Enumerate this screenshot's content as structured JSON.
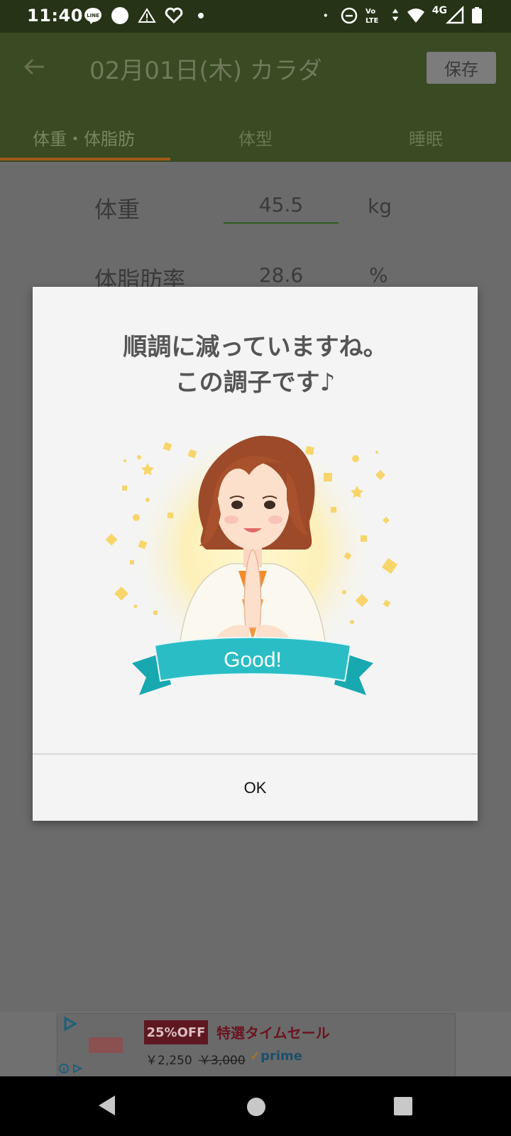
{
  "status_bar": {
    "time": "11:40",
    "left_icons": [
      "line-icon",
      "circle-notification-icon",
      "warning-icon",
      "heart-app-icon",
      "dot-icon"
    ],
    "right_icons": [
      "dot-icon",
      "do-not-disturb-icon",
      "volte-icon",
      "data-arrows-icon",
      "wifi-icon",
      "signal-icon",
      "battery-icon"
    ],
    "network": "4G"
  },
  "app_bar": {
    "title": "02月01日(木) カラダ",
    "save_label": "保存",
    "tabs": [
      {
        "label": "体重・体脂肪",
        "active": true
      },
      {
        "label": "体型",
        "active": false
      },
      {
        "label": "睡眠",
        "active": false
      }
    ]
  },
  "form": {
    "weight_label": "体重",
    "weight_value": "45.5",
    "weight_unit": "kg",
    "fat_label": "体脂肪率",
    "fat_value": "28.6",
    "fat_unit": "%"
  },
  "dialog": {
    "message_line1": "順調に減っていますね。",
    "message_line2": "この調子です♪",
    "badge_text": "Good!",
    "ok_label": "OK"
  },
  "ad": {
    "badge": "25%OFF",
    "title": "特選タイムセール",
    "price": "￥2,250",
    "old_price": "￥3,000",
    "prime": "prime"
  },
  "colors": {
    "app_bar": "#3a4a22",
    "status_bar": "#263316",
    "tab_indicator": "#a05a16",
    "ribbon": "#2bbdc6",
    "ad_badge": "#5e1820"
  }
}
